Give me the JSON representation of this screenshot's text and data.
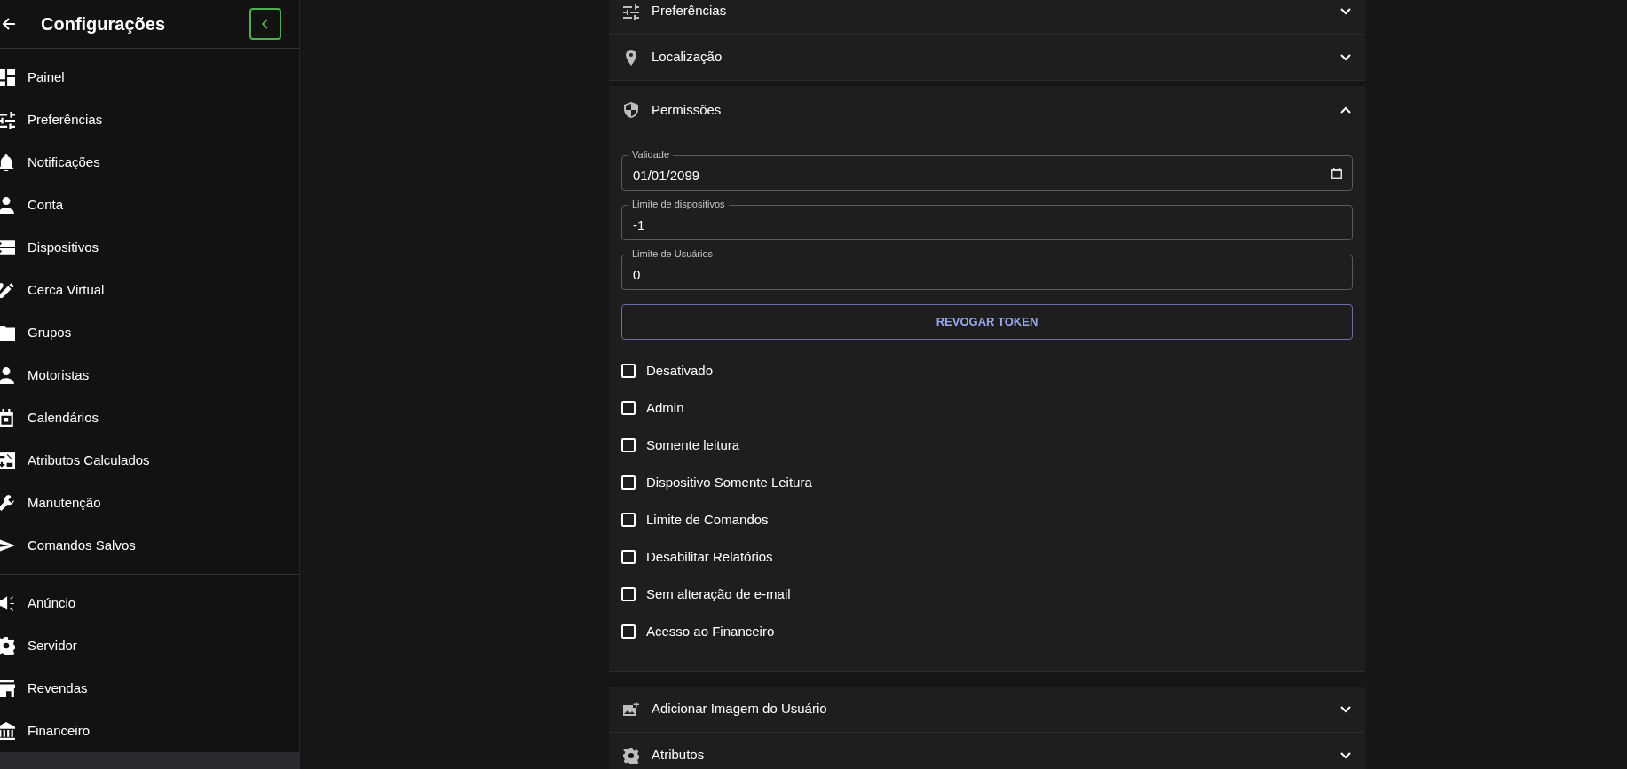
{
  "sidebar": {
    "title": "Configurações",
    "groups": [
      {
        "items": [
          {
            "label": "Painel",
            "selected": false
          },
          {
            "label": "Preferências",
            "selected": false
          },
          {
            "label": "Notificações",
            "selected": false
          },
          {
            "label": "Conta",
            "selected": false
          },
          {
            "label": "Dispositivos",
            "selected": false
          },
          {
            "label": "Cerca Virtual",
            "selected": false
          },
          {
            "label": "Grupos",
            "selected": false
          },
          {
            "label": "Motoristas",
            "selected": false
          },
          {
            "label": "Calendários",
            "selected": false
          },
          {
            "label": "Atributos Calculados",
            "selected": false
          },
          {
            "label": "Manutenção",
            "selected": false
          },
          {
            "label": "Comandos Salvos",
            "selected": false
          }
        ]
      },
      {
        "items": [
          {
            "label": "Anúncio",
            "selected": false
          },
          {
            "label": "Servidor",
            "selected": false
          },
          {
            "label": "Revendas",
            "selected": false
          },
          {
            "label": "Financeiro",
            "selected": false
          },
          {
            "selected": true
          }
        ]
      }
    ]
  },
  "sections": [
    {
      "title": "Preferências",
      "expanded": false
    },
    {
      "title": "Localização",
      "expanded": false
    },
    {
      "title": "Permissões",
      "expanded": true,
      "fields": [
        {
          "label": "Validade",
          "value": "01/01/2099",
          "kind": "date"
        },
        {
          "label": "Limite de dispositivos",
          "value": "-1",
          "kind": "text"
        },
        {
          "label": "Limite de Usuários",
          "value": "0",
          "kind": "text"
        }
      ],
      "button": "REVOGAR TOKEN",
      "checkboxes": [
        {
          "label": "Desativado",
          "checked": false
        },
        {
          "label": "Admin",
          "checked": false
        },
        {
          "label": "Somente leitura",
          "checked": false
        },
        {
          "label": "Dispositivo Somente Leitura",
          "checked": false
        },
        {
          "label": "Limite de Comandos",
          "checked": false
        },
        {
          "label": "Desabilitar Relatórios",
          "checked": false
        },
        {
          "label": "Sem alteração de e-mail",
          "checked": false
        },
        {
          "label": "Acesso ao Financeiro",
          "checked": false
        }
      ]
    },
    {
      "title": "Adicionar Imagem do Usuário",
      "expanded": false
    },
    {
      "title": "Atributos",
      "expanded": false
    }
  ]
}
